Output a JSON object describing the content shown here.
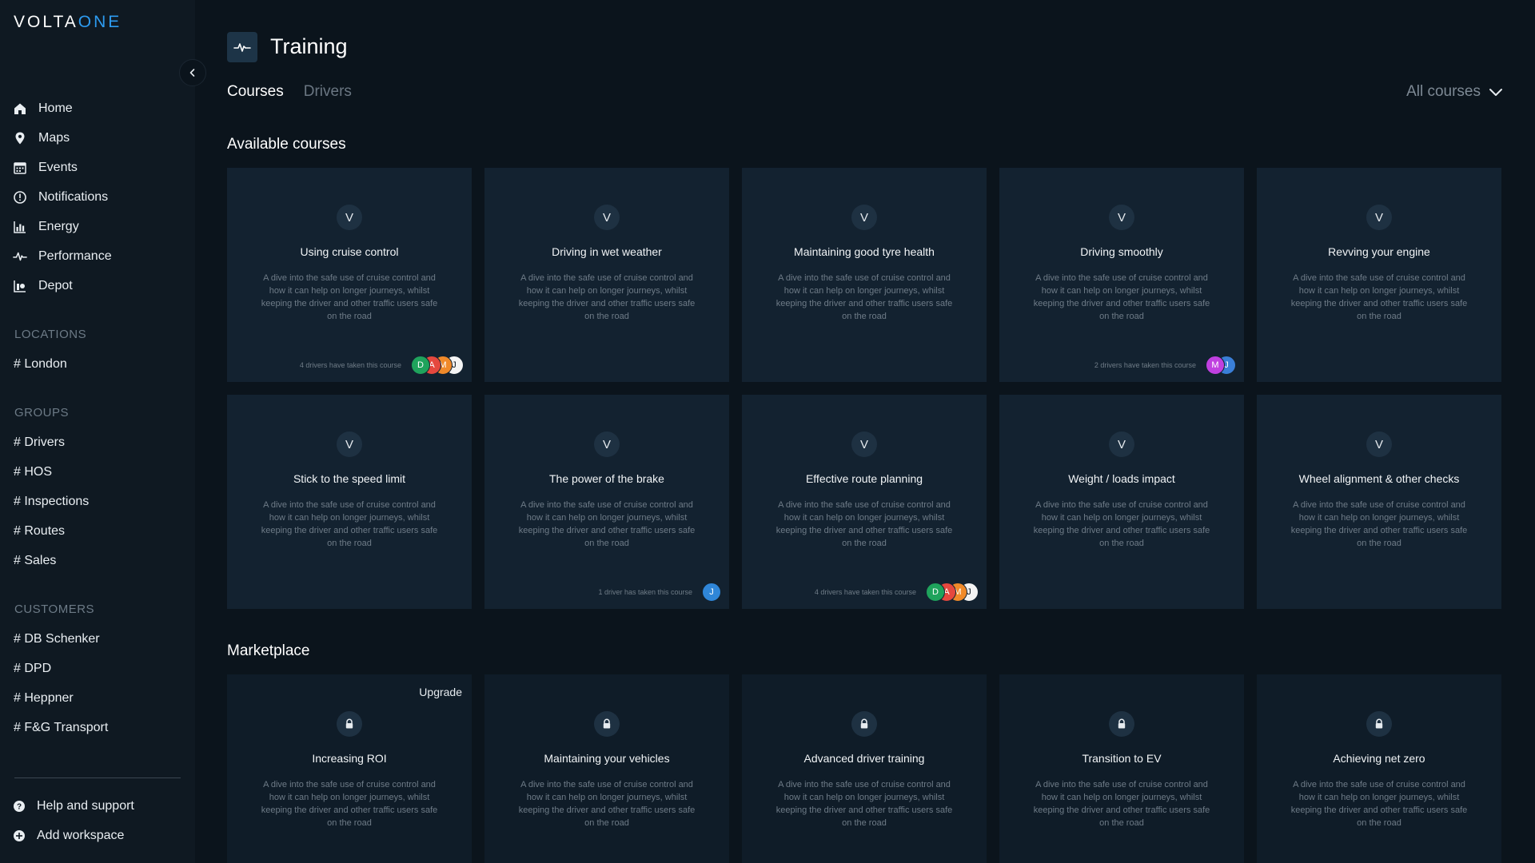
{
  "app": {
    "logo_main": "VOLTA",
    "logo_suffix": "ONE"
  },
  "sidebar": {
    "nav": [
      {
        "label": "Home",
        "icon": "home-icon"
      },
      {
        "label": "Maps",
        "icon": "map-pin-icon"
      },
      {
        "label": "Events",
        "icon": "calendar-icon"
      },
      {
        "label": "Notifications",
        "icon": "alert-circle-icon"
      },
      {
        "label": "Energy",
        "icon": "bar-chart-icon"
      },
      {
        "label": "Performance",
        "icon": "pulse-icon"
      },
      {
        "label": "Depot",
        "icon": "depot-icon"
      }
    ],
    "locations_title": "LOCATIONS",
    "locations": [
      "# London"
    ],
    "groups_title": "GROUPS",
    "groups": [
      "# Drivers",
      "# HOS",
      "# Inspections",
      "# Routes",
      "# Sales"
    ],
    "customers_title": "CUSTOMERS",
    "customers": [
      "# DB Schenker",
      "# DPD",
      "# Heppner",
      "# F&G Transport"
    ],
    "bottom": [
      {
        "label": "Help and support",
        "icon": "help-icon"
      },
      {
        "label": "Add workspace",
        "icon": "plus-circle-icon"
      }
    ]
  },
  "header": {
    "title": "Training",
    "tabs": [
      "Courses",
      "Drivers"
    ],
    "filter_label": "All courses"
  },
  "available": {
    "heading": "Available courses",
    "badge": "V",
    "courses": [
      {
        "title": "Using cruise control",
        "desc": "A dive into the safe use of cruise control and how it can help on longer journeys, whilst keeping the driver and other traffic users safe on the road",
        "count": "4 drivers have taken this course",
        "avatars": [
          [
            "D",
            "#1fa35c"
          ],
          [
            "A",
            "#e5483e"
          ],
          [
            "M",
            "#f08a2a"
          ],
          [
            "J",
            "#f4f4f4"
          ]
        ]
      },
      {
        "title": "Driving in wet weather",
        "desc": "A dive into the safe use of cruise control and how it can help on longer journeys, whilst keeping the driver and other traffic users safe on the road",
        "count": "",
        "avatars": []
      },
      {
        "title": "Maintaining good tyre health",
        "desc": "A dive into the safe use of cruise control and how it can help on longer journeys, whilst keeping the driver and other traffic users safe on the road",
        "count": "",
        "avatars": []
      },
      {
        "title": "Driving smoothly",
        "desc": "A dive into the safe use of cruise control and how it can help on longer journeys, whilst keeping the driver and other traffic users safe on the road",
        "count": "2 drivers have taken this course",
        "avatars": [
          [
            "M",
            "#c040e0"
          ],
          [
            "J",
            "#3a7fd8"
          ]
        ]
      },
      {
        "title": "Revving your engine",
        "desc": "A dive into the safe use of cruise control and how it can help on longer journeys, whilst keeping the driver and other traffic users safe on the road",
        "count": "",
        "avatars": []
      },
      {
        "title": "Stick to the speed limit",
        "desc": "A dive into the safe use of cruise control and how it can help on longer journeys, whilst keeping the driver and other traffic users safe on the road",
        "count": "",
        "avatars": []
      },
      {
        "title": "The power of the brake",
        "desc": "A dive into the safe use of cruise control and how it can help on longer journeys, whilst keeping the driver and other traffic users safe on the road",
        "count": "1 driver has taken this course",
        "avatars": [
          [
            "J",
            "#2f86d8"
          ]
        ]
      },
      {
        "title": "Effective route planning",
        "desc": "A dive into the safe use of cruise control and how it can help on longer journeys, whilst keeping the driver and other traffic users safe on the road",
        "count": "4 drivers have taken this course",
        "avatars": [
          [
            "D",
            "#1fa35c"
          ],
          [
            "A",
            "#e5483e"
          ],
          [
            "M",
            "#f08a2a"
          ],
          [
            "J",
            "#f4f4f4"
          ]
        ]
      },
      {
        "title": "Weight / loads impact",
        "desc": "A dive into the safe use of cruise control and how it can help on longer journeys, whilst keeping the driver and other traffic users safe on the road",
        "count": "",
        "avatars": []
      },
      {
        "title": "Wheel alignment & other checks",
        "desc": "A dive into the safe use of cruise control and how it can help on longer journeys, whilst keeping the driver and other traffic users safe on the road",
        "count": "",
        "avatars": []
      }
    ]
  },
  "marketplace": {
    "heading": "Marketplace",
    "upgrade_label": "Upgrade",
    "courses": [
      {
        "title": "Increasing ROI",
        "desc": "A dive into the safe use of cruise control and how it can help on longer journeys, whilst keeping the driver and other traffic users safe on the road"
      },
      {
        "title": "Maintaining your vehicles",
        "desc": "A dive into the safe use of cruise control and how it can help on longer journeys, whilst keeping the driver and other traffic users safe on the road"
      },
      {
        "title": "Advanced driver training",
        "desc": "A dive into the safe use of cruise control and how it can help on longer journeys, whilst keeping the driver and other traffic users safe on the road"
      },
      {
        "title": "Transition to EV",
        "desc": "A dive into the safe use of cruise control and how it can help on longer journeys, whilst keeping the driver and other traffic users safe on the road"
      },
      {
        "title": "Achieving net zero",
        "desc": "A dive into the safe use of cruise control and how it can help on longer journeys, whilst keeping the driver and other traffic users safe on the road"
      }
    ]
  },
  "colors": {
    "accent": "#2d9bf0",
    "background": "#0b141c",
    "card": "#132230",
    "sidebar": "#0f1922"
  }
}
